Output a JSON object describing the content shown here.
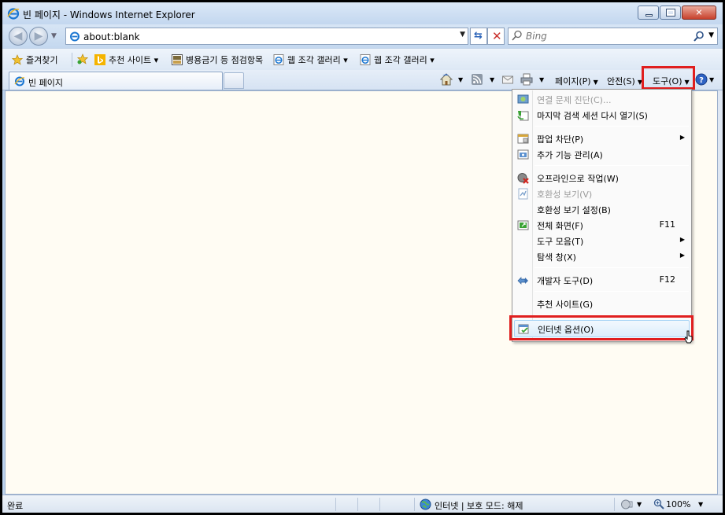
{
  "window": {
    "title": "빈 페이지 - Windows Internet Explorer"
  },
  "address": {
    "url": "about:blank",
    "search_placeholder": "Bing"
  },
  "favorites_bar": {
    "favorites_label": "즐겨찾기",
    "items": [
      {
        "label": "추천 사이트 ▾"
      },
      {
        "label": "병용금기 등 점검항목"
      },
      {
        "label": "웹 조각 갤러리 ▾"
      },
      {
        "label": "웹 조각 갤러리 ▾"
      }
    ]
  },
  "tab": {
    "label": "빈 페이지"
  },
  "commands": {
    "page": "페이지(P)",
    "safety": "안전(S)",
    "tools": "도구(O)"
  },
  "tools_menu": {
    "items": [
      {
        "label": "연결 문제 진단(C)...",
        "icon": "diagnose-icon",
        "disabled": true
      },
      {
        "label": "마지막 검색 세션 다시 열기(S)",
        "icon": "reopen-session-icon"
      },
      {
        "label": "팝업 차단(P)",
        "icon": "popup-blocker-icon",
        "submenu": true
      },
      {
        "label": "추가 기능 관리(A)",
        "icon": "addons-icon"
      },
      {
        "label": "오프라인으로 작업(W)",
        "icon": "offline-icon"
      },
      {
        "label": "호환성 보기(V)",
        "icon": "compat-view-icon",
        "disabled": true
      },
      {
        "label": "호환성 보기 설정(B)"
      },
      {
        "label": "전체 화면(F)",
        "shortcut": "F11",
        "icon": "fullscreen-icon"
      },
      {
        "label": "도구 모음(T)",
        "submenu": true
      },
      {
        "label": "탐색 창(X)",
        "submenu": true
      },
      {
        "label": "개발자 도구(D)",
        "shortcut": "F12",
        "icon": "developer-tools-icon"
      },
      {
        "label": "추천 사이트(G)"
      },
      {
        "label": "인터넷 옵션(O)",
        "icon": "internet-options-icon",
        "hovered": true
      }
    ]
  },
  "status": {
    "text": "완료",
    "zone": "인터넷 | 보호 모드: 해제",
    "zoom": "100%"
  },
  "colors": {
    "highlight": "#e01f1f",
    "content_bg": "#fffcf3"
  }
}
